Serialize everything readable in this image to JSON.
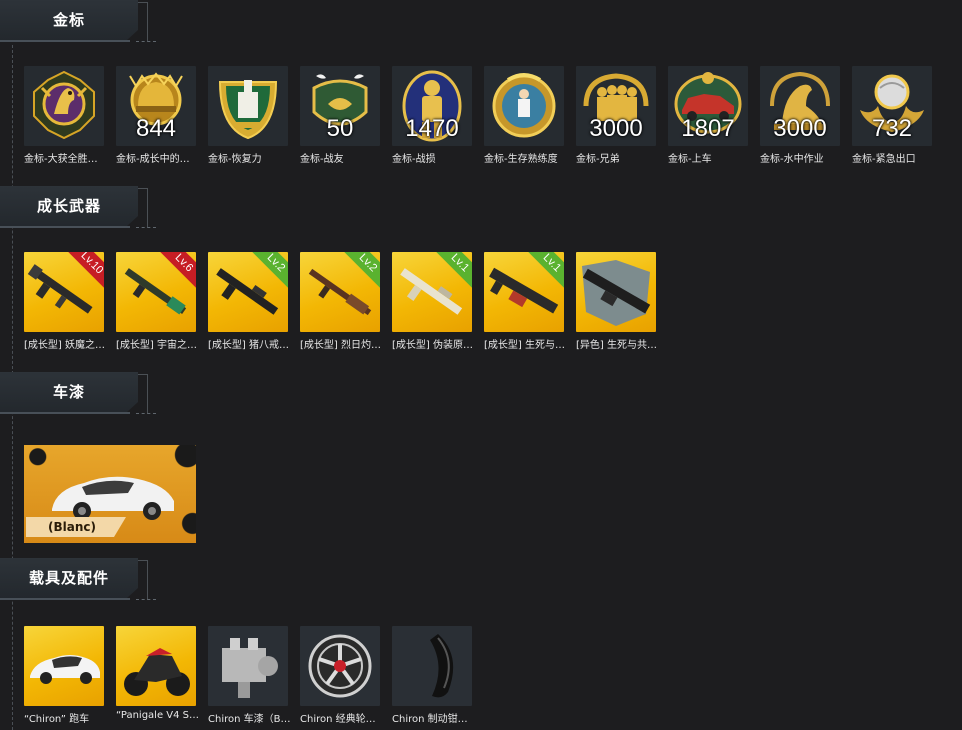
{
  "sections": {
    "gold": {
      "title": "金标"
    },
    "weapons": {
      "title": "成长武器"
    },
    "paint": {
      "title": "车漆"
    },
    "vehicles": {
      "title": "载具及配件"
    }
  },
  "gold_items": [
    {
      "caption": "金标-大获全胜…",
      "count": "",
      "icon": "eagle-medal-icon"
    },
    {
      "caption": "金标-成长中的…",
      "count": "844",
      "icon": "helmet-medal-icon"
    },
    {
      "caption": "金标-恢复力",
      "count": "",
      "icon": "medic-medal-icon"
    },
    {
      "caption": "金标-战友",
      "count": "50",
      "icon": "dove-medal-icon"
    },
    {
      "caption": "金标-战损",
      "count": "1470",
      "icon": "soldier-medal-icon"
    },
    {
      "caption": "金标-生存熟练度",
      "count": "",
      "icon": "survivor-medal-icon"
    },
    {
      "caption": "金标-兄弟",
      "count": "3000",
      "icon": "squad-medal-icon"
    },
    {
      "caption": "金标-上车",
      "count": "1807",
      "icon": "car-medal-icon"
    },
    {
      "caption": "金标-水中作业",
      "count": "3000",
      "icon": "sealion-medal-icon"
    },
    {
      "caption": "金标-紧急出口",
      "count": "732",
      "icon": "parachute-medal-icon"
    }
  ],
  "weapon_items": [
    {
      "caption": "[成长型] 妖魔之…",
      "level": "Lv.10",
      "level_color": "#c61d24"
    },
    {
      "caption": "[成长型] 宇宙之…",
      "level": "Lv.6",
      "level_color": "#c61d24"
    },
    {
      "caption": "[成长型] 猪八戒…",
      "level": "Lv.2",
      "level_color": "#5ab22f"
    },
    {
      "caption": "[成长型] 烈日灼…",
      "level": "Lv.2",
      "level_color": "#5ab22f"
    },
    {
      "caption": "[成长型] 伪装原…",
      "level": "Lv.1",
      "level_color": "#5ab22f"
    },
    {
      "caption": "[成长型] 生死与…",
      "level": "Lv.1",
      "level_color": "#5ab22f"
    },
    {
      "caption": "[异色] 生死与共…",
      "level": "",
      "level_color": ""
    }
  ],
  "paint_item": {
    "label": "(Blanc)",
    "icon": "bugatti-car-icon"
  },
  "vehicle_items": [
    {
      "caption": "“Chiron” 跑车",
      "icon": "supercar-icon"
    },
    {
      "caption": "“Panigale V4 S…",
      "icon": "motorcycle-icon"
    },
    {
      "caption": "Chiron 车漆（B…",
      "icon": "engine-icon"
    },
    {
      "caption": "Chiron 经典轮…",
      "icon": "wheel-rim-icon"
    },
    {
      "caption": "Chiron 制动钳…",
      "icon": "brake-caliper-icon"
    }
  ],
  "colors": {
    "background": "#1d1d1f",
    "gold_tile": "#f3b704",
    "level_red": "#c61d24",
    "level_green": "#5ab22f"
  }
}
